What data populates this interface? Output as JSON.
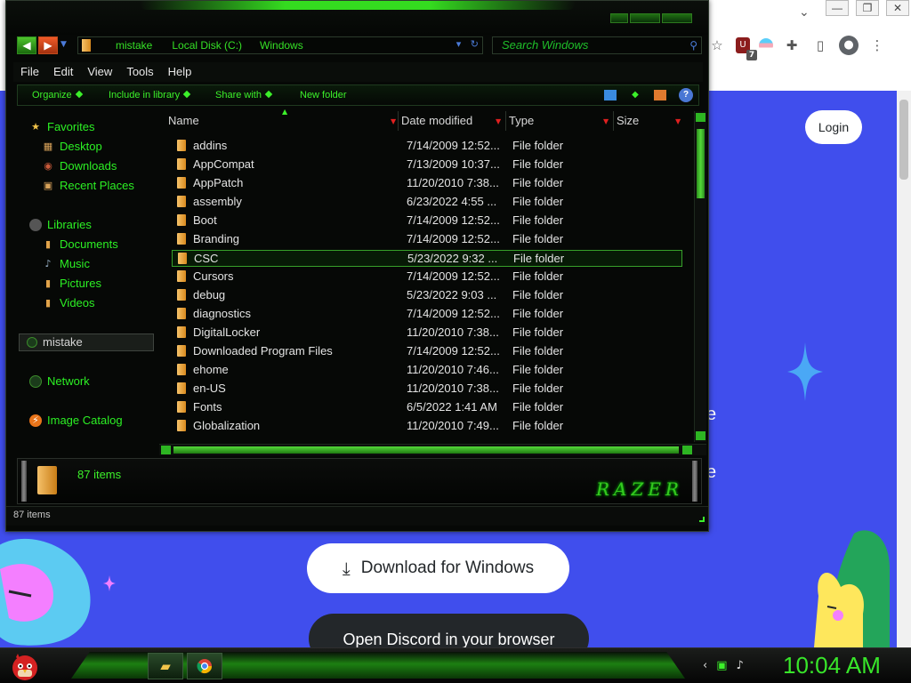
{
  "browser": {
    "tab_chevron": "⌄",
    "window_controls": [
      "—",
      "❐",
      "✕"
    ],
    "toolbar_icons": [
      "star-icon",
      "extension-shield-icon",
      "pride-extension-icon",
      "puzzle-icon",
      "sidepanel-icon",
      "profile-icon",
      "menu-icon"
    ],
    "extension_badge": "7"
  },
  "discord": {
    "login": "Login",
    "download_button": "Download for Windows",
    "open_button": "Open Discord in your browser",
    "accent": "#404eed"
  },
  "explorer": {
    "address": {
      "crumbs": [
        "mistake",
        "Local Disk (C:)",
        "Windows"
      ]
    },
    "search_placeholder": "Search Windows",
    "menu": [
      "File",
      "Edit",
      "View",
      "Tools",
      "Help"
    ],
    "commands": [
      "Organize",
      "Include in library",
      "Share with",
      "New folder"
    ],
    "nav": {
      "favorites": "Favorites",
      "desktop": "Desktop",
      "downloads": "Downloads",
      "recent": "Recent Places",
      "libraries": "Libraries",
      "documents": "Documents",
      "music": "Music",
      "pictures": "Pictures",
      "videos": "Videos",
      "user": "mistake",
      "network": "Network",
      "image_catalog": "Image Catalog"
    },
    "columns": [
      "Name",
      "Date modified",
      "Type",
      "Size"
    ],
    "files": [
      {
        "name": "addins",
        "date": "7/14/2009 12:52...",
        "type": "File folder"
      },
      {
        "name": "AppCompat",
        "date": "7/13/2009 10:37...",
        "type": "File folder"
      },
      {
        "name": "AppPatch",
        "date": "11/20/2010 7:38...",
        "type": "File folder"
      },
      {
        "name": "assembly",
        "date": "6/23/2022 4:55 ...",
        "type": "File folder"
      },
      {
        "name": "Boot",
        "date": "7/14/2009 12:52...",
        "type": "File folder"
      },
      {
        "name": "Branding",
        "date": "7/14/2009 12:52...",
        "type": "File folder"
      },
      {
        "name": "CSC",
        "date": "5/23/2022 9:32 ...",
        "type": "File folder"
      },
      {
        "name": "Cursors",
        "date": "7/14/2009 12:52...",
        "type": "File folder"
      },
      {
        "name": "debug",
        "date": "5/23/2022 9:03 ...",
        "type": "File folder"
      },
      {
        "name": "diagnostics",
        "date": "7/14/2009 12:52...",
        "type": "File folder"
      },
      {
        "name": "DigitalLocker",
        "date": "11/20/2010 7:38...",
        "type": "File folder"
      },
      {
        "name": "Downloaded Program Files",
        "date": "7/14/2009 12:52...",
        "type": "File folder"
      },
      {
        "name": "ehome",
        "date": "11/20/2010 7:46...",
        "type": "File folder"
      },
      {
        "name": "en-US",
        "date": "11/20/2010 7:38...",
        "type": "File folder"
      },
      {
        "name": "Fonts",
        "date": "6/5/2022 1:41 AM",
        "type": "File folder"
      },
      {
        "name": "Globalization",
        "date": "11/20/2010 7:49...",
        "type": "File folder"
      }
    ],
    "selected_file": "CSC",
    "item_count": "87 items",
    "status_text": "87 items",
    "brand": "RAZER",
    "accent": "#3cf02a"
  },
  "taskbar": {
    "clock": "10:04 AM",
    "tray_icons": [
      "tray-arrow-icon",
      "network-icon",
      "volume-icon"
    ]
  }
}
